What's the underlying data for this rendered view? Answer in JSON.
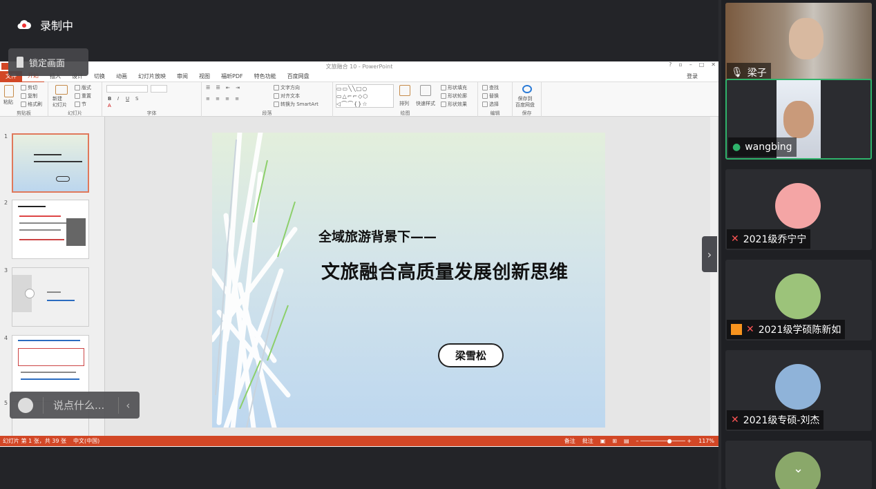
{
  "recording": {
    "status": "录制中",
    "lock_label": "锁定画面"
  },
  "ppt": {
    "window_title": "文旅融合 10 - PowerPoint",
    "tabs": [
      "文件",
      "开始",
      "插入",
      "设计",
      "切换",
      "动画",
      "幻灯片放映",
      "审阅",
      "视图",
      "福昕PDF",
      "特色功能",
      "百度网盘"
    ],
    "login": "登录",
    "groups": [
      "剪贴板",
      "幻灯片",
      "字体",
      "段落",
      "绘图",
      "编辑",
      "保存"
    ],
    "ribbon_items": {
      "cut": "剪切",
      "copy": "复制",
      "format_painter": "格式刷",
      "paste": "粘贴",
      "new_slide": "新建\n幻灯片",
      "layout": "版式",
      "reset": "重置",
      "section": "节",
      "text_dir": "文字方向",
      "align_text": "对齐文本",
      "smartart": "转换为 SmartArt",
      "arrange": "排列",
      "quick_styles": "快速样式",
      "shape_fill": "形状填充",
      "shape_outline": "形状轮廓",
      "shape_effect": "形状效果",
      "find": "查找",
      "replace": "替换",
      "select": "选择",
      "save_to": "保存到\n百度网盘"
    },
    "thumb_numbers": [
      "1",
      "2",
      "3",
      "4",
      "5"
    ],
    "slide": {
      "subtitle": "全域旅游背景下——",
      "title": "文旅融合高质量发展创新思维",
      "author": "梁雪松"
    },
    "status": {
      "slide_info": "幻灯片 第 1 张，共 39 张",
      "language": "中文(中国)",
      "notes": "备注",
      "comments": "批注",
      "zoom": "117%"
    }
  },
  "chat": {
    "placeholder": "说点什么..."
  },
  "participants": [
    {
      "name": "梁子",
      "mic": "on"
    },
    {
      "name": "wangbing",
      "mic": "on",
      "active": true
    },
    {
      "name": "2021级乔宁宁",
      "mic": "muted"
    },
    {
      "name": "2021级学硕陈新如",
      "mic": "muted"
    },
    {
      "name": "2021级专硕-刘杰",
      "mic": "muted"
    }
  ],
  "colors": {
    "accent": "#d24726",
    "active_speaker": "#2fb36b",
    "panel_bg": "#1f2024"
  }
}
